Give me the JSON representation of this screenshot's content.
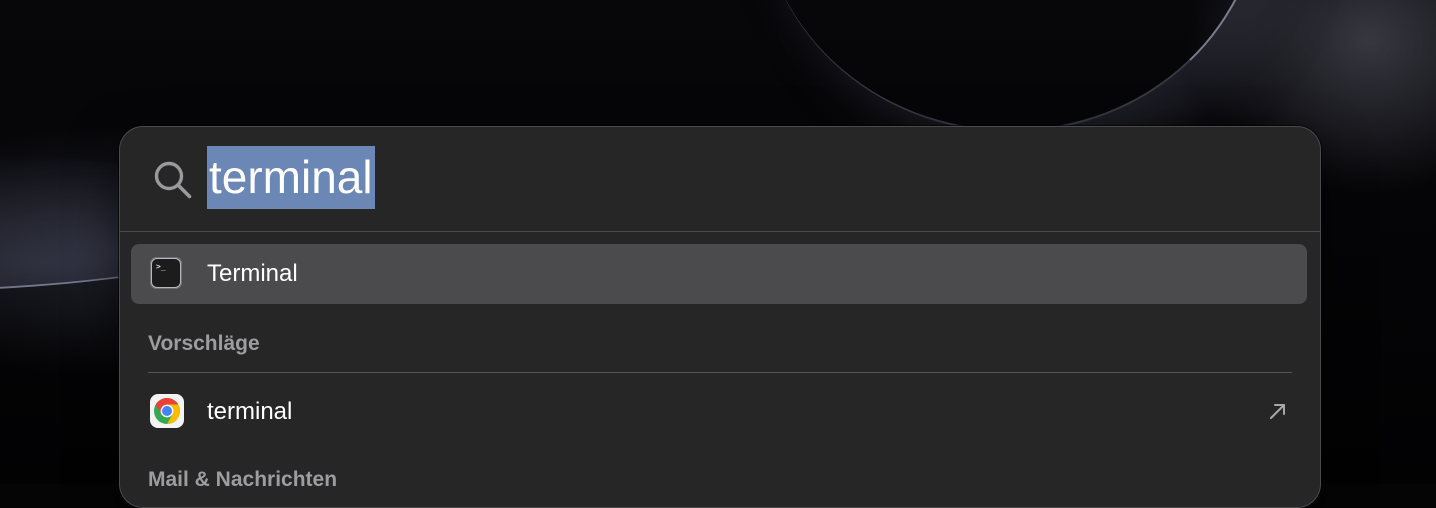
{
  "search": {
    "query": "terminal"
  },
  "top_hit": {
    "label": "Terminal",
    "icon": "terminal-app-icon"
  },
  "sections": [
    {
      "title": "Vorschläge",
      "items": [
        {
          "label": "terminal",
          "icon": "chrome-app-icon",
          "action_icon": "arrow-up-right-icon"
        }
      ]
    },
    {
      "title": "Mail & Nachrichten"
    }
  ],
  "colors": {
    "selection_highlight": "#6a87b5",
    "selected_row": "#4b4b4d",
    "panel_background": "#262627"
  }
}
